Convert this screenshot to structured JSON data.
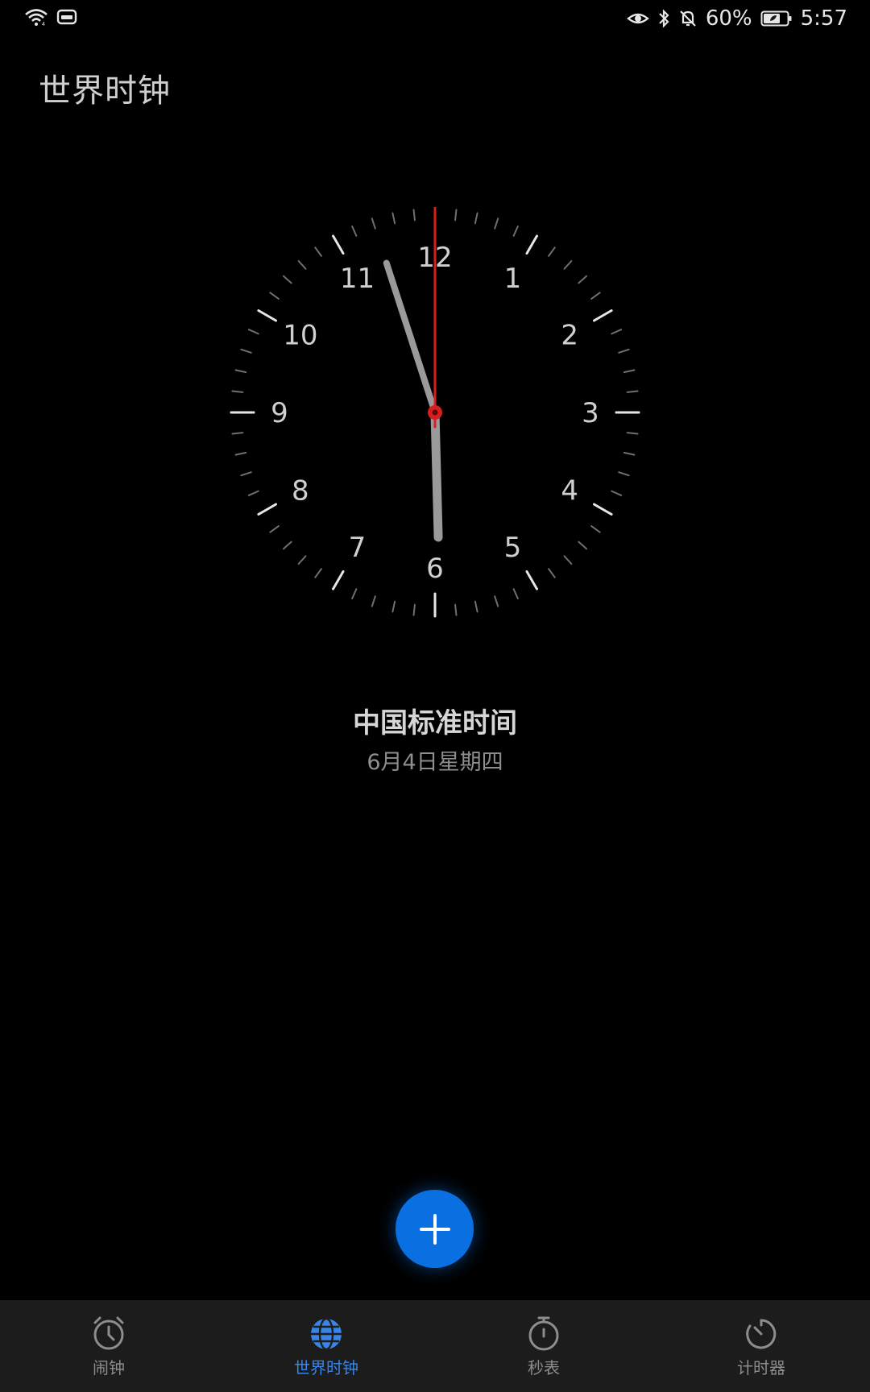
{
  "status_bar": {
    "battery_percent": "60%",
    "time": "5:57",
    "icons": [
      "wifi-icon",
      "network-activity-icon",
      "eye-comfort-icon",
      "bluetooth-icon",
      "mute-bell-icon",
      "battery-icon"
    ]
  },
  "header": {
    "title": "世界时钟"
  },
  "clock": {
    "numerals": [
      "12",
      "1",
      "2",
      "3",
      "4",
      "5",
      "6",
      "7",
      "8",
      "9",
      "10",
      "11"
    ],
    "time": {
      "hour": 5,
      "minute": 57,
      "second": 0
    },
    "colors": {
      "second_hand": "#d81e1e",
      "hands": "#9a9a9a",
      "ticks": "#cfcfcf"
    }
  },
  "timezone": {
    "name": "中国标准时间",
    "date": "6月4日星期四"
  },
  "fab": {
    "icon": "plus-icon",
    "color": "#0a6fe0"
  },
  "bottom_nav": {
    "active_color": "#3a84e6",
    "items": [
      {
        "label": "闹钟",
        "icon": "alarm-clock-icon",
        "active": false
      },
      {
        "label": "世界时钟",
        "icon": "globe-icon",
        "active": true
      },
      {
        "label": "秒表",
        "icon": "stopwatch-icon",
        "active": false
      },
      {
        "label": "计时器",
        "icon": "timer-icon",
        "active": false
      }
    ]
  }
}
